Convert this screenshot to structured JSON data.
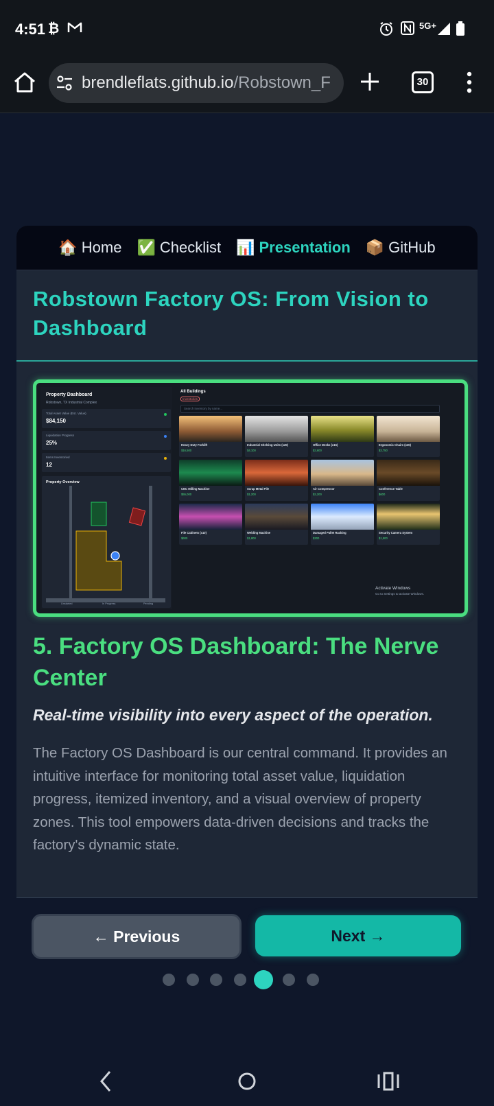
{
  "status_bar": {
    "time": "4:51",
    "network": "5G+"
  },
  "browser": {
    "url_host": "brendleflats.github.io",
    "url_path": "/Robstown_F",
    "tab_count": "30"
  },
  "nav": {
    "items": [
      {
        "emoji": "🏠",
        "label": "Home"
      },
      {
        "emoji": "✅",
        "label": "Checklist"
      },
      {
        "emoji": "📊",
        "label": "Presentation"
      },
      {
        "emoji": "📦",
        "label": "GitHub"
      }
    ],
    "active": "Presentation"
  },
  "presentation_title": "Robstown Factory OS: From Vision to Dashboard",
  "screenshot": {
    "left_title": "Property Dashboard",
    "left_subtitle": "Robstown, TX Industrial Complex",
    "kpis": [
      {
        "label": "Total Asset Value (Est. Value)",
        "value": "$84,150",
        "color": "#22c55e"
      },
      {
        "label": "Liquidation Progress",
        "value": "25%",
        "color": "#3b82f6"
      },
      {
        "label": "Items Inventoried",
        "value": "12",
        "color": "#eab308"
      }
    ],
    "overview_title": "Property Overview",
    "overview_legend": [
      "Unstarted",
      "In Progress",
      "Pending"
    ],
    "right_title": "All Buildings",
    "right_badge": "Inventories",
    "search_placeholder": "Search inventory by name...",
    "items": [
      {
        "name": "Heavy Duty Forklift",
        "price": "$16,500",
        "img": "linear-gradient(180deg,#f4c27a,#8d5a34 60%,#2c2620)"
      },
      {
        "name": "Industrial Shelving Units (x20)",
        "price": "$4,100",
        "img": "linear-gradient(180deg,#e5e5e5,#9a9a9a 60%,#555)"
      },
      {
        "name": "Office Desks (x15)",
        "price": "$3,600",
        "img": "linear-gradient(180deg,#e9e28a,#8a8a2a 55%,#2f3a16)"
      },
      {
        "name": "Ergonomic Chairs (x30)",
        "price": "$3,750",
        "img": "linear-gradient(180deg,#f3e6d2,#c8b497 60%,#6d5a44)"
      },
      {
        "name": "CNC Milling Machine",
        "price": "$55,000",
        "img": "linear-gradient(180deg,#0f3d2a,#1d8a4f 50%,#0b1a14)"
      },
      {
        "name": "Scrap Metal Pile",
        "price": "$1,200",
        "img": "linear-gradient(180deg,#7a2d1a,#d9683a 50%,#3a1409)"
      },
      {
        "name": "Air Compressor",
        "price": "$2,200",
        "img": "linear-gradient(180deg,#a9c4e0,#d9b88a 55%,#5a4a3a)"
      },
      {
        "name": "Conference Table",
        "price": "$600",
        "img": "linear-gradient(180deg,#3a2a18,#6a4a28 50%,#1a120a)"
      },
      {
        "name": "File Cabinets (x10)",
        "price": "$600",
        "img": "linear-gradient(180deg,#1c2a4a,#c64fb0 50%,#17223a)"
      },
      {
        "name": "Welding Machine",
        "price": "$1,800",
        "img": "linear-gradient(180deg,#2b3a5a,#5a4a3a 50%,#1a1a22)"
      },
      {
        "name": "Damaged Pallet Racking",
        "price": "$300",
        "img": "linear-gradient(180deg,#3b82f6,#dbeafe 50%,#94a3b8)"
      },
      {
        "name": "Security Camera System",
        "price": "$1,500",
        "img": "linear-gradient(180deg,#1f2a1a,#e8c470 40%,#22301a)"
      }
    ],
    "watermark_title": "Activate Windows",
    "watermark_sub": "Go to Settings to activate Windows."
  },
  "slide": {
    "heading": "5. Factory OS Dashboard: The Nerve Center",
    "tagline": "Real-time visibility into every aspect of the operation.",
    "body": "The Factory OS Dashboard is our central command. It provides an intuitive interface for monitoring total asset value, liquidation progress, itemized inventory, and a visual overview of property zones. This tool empowers data-driven decisions and tracks the factory's dynamic state."
  },
  "pager": {
    "prev_label": "← Previous",
    "next_label": "Next →",
    "total": 7,
    "current": 5
  },
  "colors": {
    "accent_teal": "#2dd4bf",
    "accent_green": "#4ade80",
    "page_bg": "#0f172a"
  }
}
